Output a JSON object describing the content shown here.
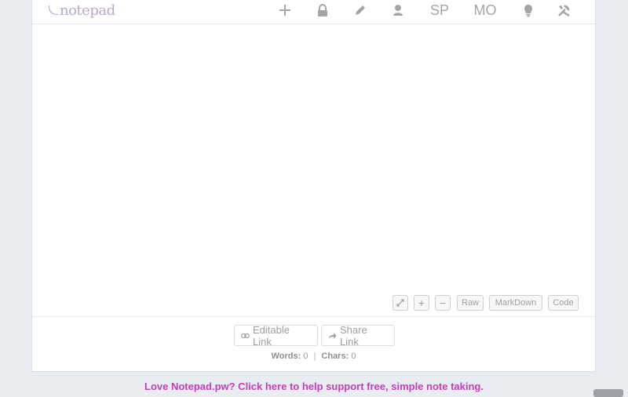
{
  "header": {
    "logo_text": "notepad",
    "nav": {
      "new_icon": "plus-icon",
      "lock_icon": "lock-icon",
      "edit_icon": "pencil-icon",
      "user_icon": "user-icon",
      "sp_label": "SP",
      "mo_label": "MO",
      "tips_icon": "lightbulb-icon",
      "tools_icon": "tools-icon"
    }
  },
  "editor": {
    "value": "",
    "placeholder": ""
  },
  "toolbar": {
    "expand_icon": "expand-icon",
    "zoom_in_label": "+",
    "zoom_out_label": "−",
    "raw_label": "Raw",
    "markdown_label": "MarkDown",
    "code_label": "Code"
  },
  "links": {
    "editable_label": "Editable Link",
    "share_label": "Share Link"
  },
  "stats": {
    "words_label": "Words:",
    "words_value": "0",
    "separator": "|",
    "chars_label": "Chars:",
    "chars_value": "0"
  },
  "footer": {
    "support_text": "Love Notepad.pw? Click here to help support free, simple note taking."
  },
  "colors": {
    "accent": "#c83bbf",
    "logo": "#b9a8c8",
    "background": "#e9ecf1"
  }
}
